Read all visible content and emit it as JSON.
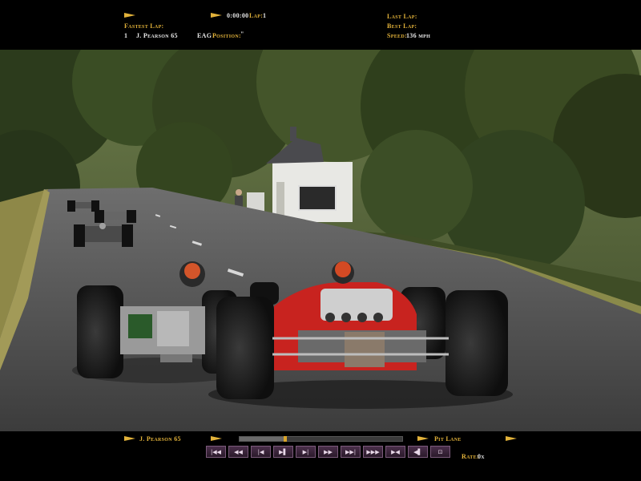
{
  "hud_top": {
    "timer": "0:00:00",
    "lap_label": "Lap:",
    "lap_value": "1",
    "fastest_lap_label": "Fastest Lap:",
    "fastest_pos": "1",
    "fastest_driver": "J. Pearson 65",
    "fastest_team": "EAG",
    "position_label": "Position:",
    "position_value": "\"",
    "last_lap_label": "Last Lap:",
    "best_lap_label": "Best Lap:",
    "speed_label": "Speed:",
    "speed_value": "136 mph"
  },
  "hud_bottom": {
    "driver": "J. Pearson 65",
    "pit_lane": "Pit Lane",
    "replay_progress": 0.28,
    "controls": [
      "|◀◀",
      "◀◀",
      "|◀",
      "▶▌",
      "▶|",
      "▶▶",
      "▶▶|",
      "▶▶▶",
      "▶◀",
      "◀▌",
      "⊡"
    ],
    "rate_label": "Rate:",
    "rate_value": "0x"
  },
  "colors": {
    "label": "#e2b23a",
    "value": "#e8e8e8",
    "button": "#3a243a"
  }
}
